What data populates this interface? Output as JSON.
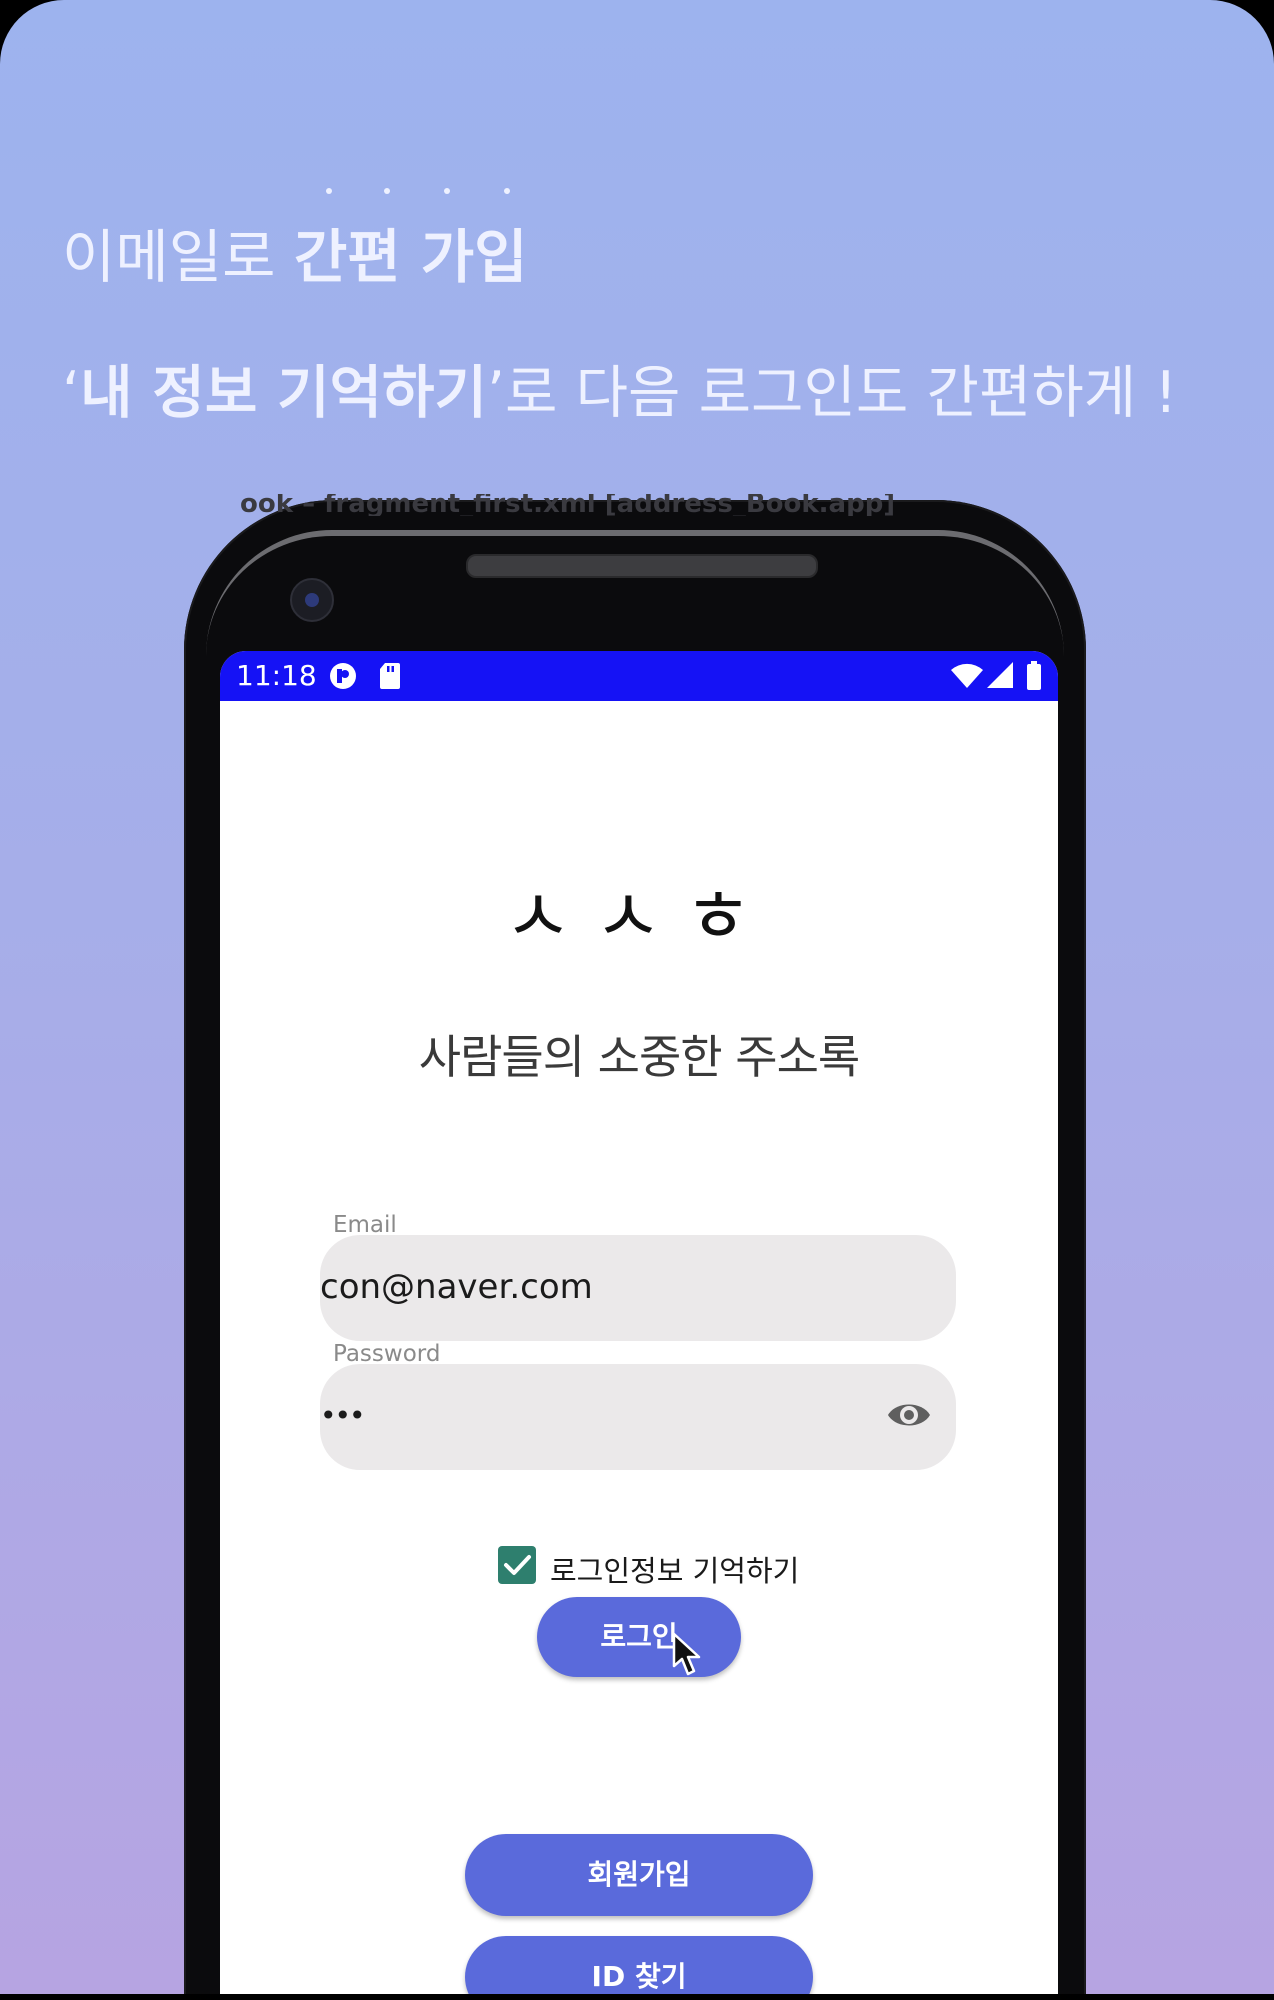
{
  "promo": {
    "line1_normal": "이메일로 ",
    "line1_bold": "간편 가입",
    "line2_quote_open": "‘",
    "line2_bold": "내 정보 기억하기",
    "line2_rest": "’로 다음 로그인도 간편하게 !"
  },
  "ide_overlay_text": "ook – fragment_first.xml [address_Book.app]",
  "status_bar": {
    "time": "11:18",
    "left_icons": [
      "notification-app-icon",
      "sd-card-icon"
    ],
    "right_icons": [
      "wifi-icon",
      "signal-icon",
      "battery-icon"
    ],
    "color": "#1512f5"
  },
  "app": {
    "logo": "ㅅㅅㅎ",
    "tagline": "사람들의 소중한 주소록"
  },
  "form": {
    "email_label": "Email",
    "email_value": "con@naver.com",
    "password_label": "Password",
    "password_value": "•••",
    "remember_label": "로그인정보 기억하기",
    "remember_checked": true,
    "login_button": "로그인",
    "signup_button": "회원가입",
    "find_id_button": "ID 찾기"
  },
  "colors": {
    "button": "#5a6adb",
    "checkbox": "#2e7f6e",
    "field_bg": "#ebe9ea",
    "gradient_top": "#9db3ee",
    "gradient_bottom": "#b6a4e2"
  }
}
